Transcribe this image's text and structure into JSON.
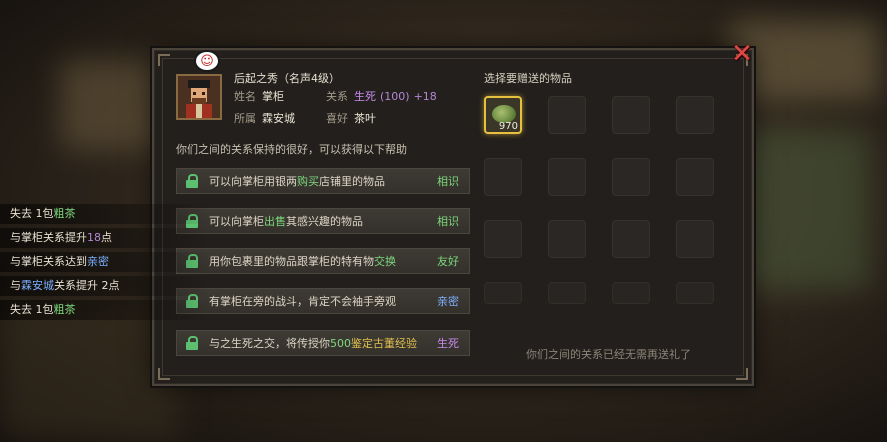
{
  "npc": {
    "title": "后起之秀（名声4级）",
    "name_label": "姓名",
    "name_value": "掌柜",
    "relation_label": "关系",
    "relation_value": "生死",
    "relation_points": "(100)",
    "relation_bonus": "+18",
    "affiliation_label": "所属",
    "affiliation_value": "霖安城",
    "hobby_label": "喜好",
    "hobby_value": "茶叶",
    "portrait_icon": "shopkeeper-portrait",
    "bubble_icon": "laugh-emote-icon"
  },
  "relationship_description": "你们之间的关系保持的很好，可以获得以下帮助",
  "benefits": [
    {
      "pre": "可以向掌柜用银两",
      "hl": "购买",
      "post": "店铺里的物品",
      "level": "相识",
      "level_color": "#7cd87c"
    },
    {
      "pre": "可以向掌柜",
      "hl": "出售",
      "post": "其感兴趣的物品",
      "level": "相识",
      "level_color": "#7cd87c"
    },
    {
      "pre": "用你包裹里的物品跟掌柜的特有物",
      "hl": "交换",
      "post": "",
      "level": "友好",
      "level_color": "#7cd87c"
    },
    {
      "pre": "有掌柜在旁的战斗，肯定不会袖手旁观",
      "hl": "",
      "post": "",
      "level": "亲密",
      "level_color": "#7cb0ff"
    },
    {
      "pre": "与之生死之交，将传授你",
      "hl": "500鉴定古董经验",
      "post": "",
      "level": "生死",
      "level_color": "#c98cf0"
    }
  ],
  "gift_panel": {
    "title": "选择要赠送的物品",
    "item_count": "970",
    "item_icon": "tea-leaf-icon",
    "empty_message": "你们之间的关系已经无需再送礼了"
  },
  "close_icon": "close-x-icon",
  "event_log": [
    {
      "pre": "失去 1包",
      "hl": "粗茶",
      "post": "",
      "cls": "g"
    },
    {
      "pre": "与掌柜关系提升",
      "hl": "18",
      "post": "点",
      "cls": "p"
    },
    {
      "pre": "与掌柜关系达到",
      "hl": "亲密",
      "post": "",
      "cls": "b"
    },
    {
      "pre": "与",
      "hl": "霖安城",
      "post": "关系提升 2点",
      "cls": "b"
    },
    {
      "pre": "失去 1包",
      "hl": "粗茶",
      "post": "",
      "cls": "g"
    }
  ]
}
